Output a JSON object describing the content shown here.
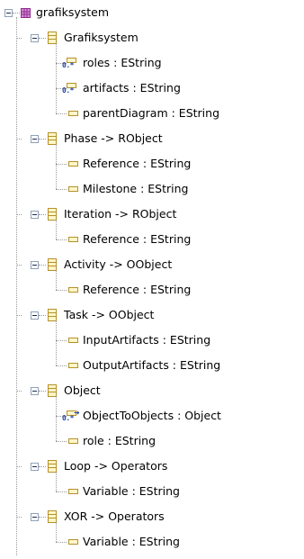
{
  "tree": {
    "root": {
      "label": "grafiksystem",
      "icon": "package-icon"
    },
    "classes": [
      {
        "label": "Grafiksystem",
        "attributes": [
          {
            "label": "roles : EString",
            "icon": "multi-valued-attribute-icon"
          },
          {
            "label": "artifacts : EString",
            "icon": "multi-valued-attribute-icon"
          },
          {
            "label": "parentDiagram : EString",
            "icon": "attribute-icon"
          }
        ]
      },
      {
        "label": "Phase -> RObject",
        "attributes": [
          {
            "label": "Reference : EString",
            "icon": "attribute-icon"
          },
          {
            "label": "Milestone : EString",
            "icon": "attribute-icon"
          }
        ]
      },
      {
        "label": "Iteration -> RObject",
        "attributes": [
          {
            "label": "Reference : EString",
            "icon": "attribute-icon"
          }
        ]
      },
      {
        "label": "Activity -> OObject",
        "attributes": [
          {
            "label": "Reference : EString",
            "icon": "attribute-icon"
          }
        ]
      },
      {
        "label": "Task -> OObject",
        "attributes": [
          {
            "label": "InputArtifacts : EString",
            "icon": "attribute-icon"
          },
          {
            "label": "OutputArtifacts : EString",
            "icon": "attribute-icon"
          }
        ]
      },
      {
        "label": "Object",
        "attributes": [
          {
            "label": "ObjectToObjects : Object",
            "icon": "multi-valued-reference-icon"
          },
          {
            "label": "role : EString",
            "icon": "attribute-icon"
          }
        ]
      },
      {
        "label": "Loop -> Operators",
        "attributes": [
          {
            "label": "Variable : EString",
            "icon": "attribute-icon"
          }
        ]
      },
      {
        "label": "XOR -> Operators",
        "attributes": [
          {
            "label": "Variable : EString",
            "icon": "attribute-icon"
          }
        ]
      }
    ]
  },
  "colors": {
    "tree_line": "#9a9a9a",
    "class_border": "#b5912b",
    "class_fill": "#fff6c9",
    "package": "#8e2a8e",
    "multiplicity": "#2046a8"
  }
}
